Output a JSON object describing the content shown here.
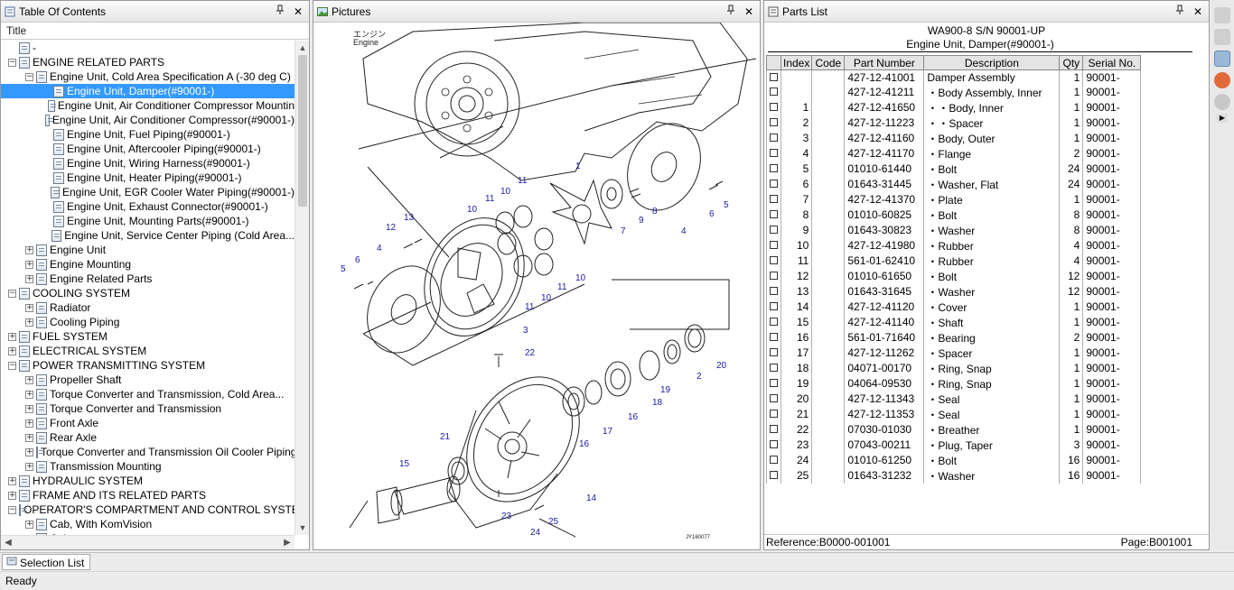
{
  "toc": {
    "title": "Table Of Contents",
    "column": "Title",
    "items": [
      {
        "level": 0,
        "exp": "",
        "label": "-"
      },
      {
        "level": 0,
        "exp": "−",
        "label": "ENGINE RELATED PARTS"
      },
      {
        "level": 1,
        "exp": "−",
        "label": "Engine Unit, Cold Area Specification A (-30 deg C)"
      },
      {
        "level": 2,
        "exp": "",
        "label": "Engine Unit, Damper(#90001-)",
        "selected": true
      },
      {
        "level": 2,
        "exp": "",
        "label": "Engine Unit, Air Conditioner Compressor Mountin"
      },
      {
        "level": 2,
        "exp": "",
        "label": "Engine Unit, Air Conditioner Compressor(#90001-)"
      },
      {
        "level": 2,
        "exp": "",
        "label": "Engine Unit, Fuel Piping(#90001-)"
      },
      {
        "level": 2,
        "exp": "",
        "label": "Engine Unit, Aftercooler Piping(#90001-)"
      },
      {
        "level": 2,
        "exp": "",
        "label": "Engine Unit, Wiring Harness(#90001-)"
      },
      {
        "level": 2,
        "exp": "",
        "label": "Engine Unit, Heater Piping(#90001-)"
      },
      {
        "level": 2,
        "exp": "",
        "label": "Engine Unit, EGR Cooler Water Piping(#90001-)"
      },
      {
        "level": 2,
        "exp": "",
        "label": "Engine Unit, Exhaust Connector(#90001-)"
      },
      {
        "level": 2,
        "exp": "",
        "label": "Engine Unit, Mounting Parts(#90001-)"
      },
      {
        "level": 2,
        "exp": "",
        "label": "Engine Unit, Service Center Piping (Cold Area..."
      },
      {
        "level": 1,
        "exp": "+",
        "label": "Engine Unit"
      },
      {
        "level": 1,
        "exp": "+",
        "label": "Engine Mounting"
      },
      {
        "level": 1,
        "exp": "+",
        "label": "Engine Related Parts"
      },
      {
        "level": 0,
        "exp": "−",
        "label": "COOLING SYSTEM"
      },
      {
        "level": 1,
        "exp": "+",
        "label": "Radiator"
      },
      {
        "level": 1,
        "exp": "+",
        "label": "Cooling Piping"
      },
      {
        "level": 0,
        "exp": "+",
        "label": "FUEL SYSTEM"
      },
      {
        "level": 0,
        "exp": "+",
        "label": "ELECTRICAL SYSTEM"
      },
      {
        "level": 0,
        "exp": "−",
        "label": "POWER TRANSMITTING SYSTEM"
      },
      {
        "level": 1,
        "exp": "+",
        "label": "Propeller Shaft"
      },
      {
        "level": 1,
        "exp": "+",
        "label": "Torque Converter and Transmission, Cold Area..."
      },
      {
        "level": 1,
        "exp": "+",
        "label": "Torque Converter and Transmission"
      },
      {
        "level": 1,
        "exp": "+",
        "label": "Front Axle"
      },
      {
        "level": 1,
        "exp": "+",
        "label": "Rear Axle"
      },
      {
        "level": 1,
        "exp": "+",
        "label": "Torque Converter and Transmission Oil Cooler Piping"
      },
      {
        "level": 1,
        "exp": "+",
        "label": "Transmission Mounting"
      },
      {
        "level": 0,
        "exp": "+",
        "label": "HYDRAULIC SYSTEM"
      },
      {
        "level": 0,
        "exp": "+",
        "label": "FRAME AND ITS RELATED PARTS"
      },
      {
        "level": 0,
        "exp": "−",
        "label": "OPERATOR'S COMPARTMENT AND CONTROL SYSTEM"
      },
      {
        "level": 1,
        "exp": "+",
        "label": "Cab, With KomVision"
      },
      {
        "level": 1,
        "exp": "+",
        "label": "Cab"
      }
    ]
  },
  "pictures": {
    "title": "Pictures",
    "label_jp": "エンジン",
    "label_en": "Engine",
    "drawing_code": "JY160077"
  },
  "parts": {
    "title": "Parts List",
    "model": "WA900-8 S/N 90001-UP",
    "subtitle": "Engine Unit, Damper(#90001-)",
    "columns": [
      "Index",
      "Code",
      "Part Number",
      "Description",
      "Qty",
      "Serial No."
    ],
    "rows": [
      [
        "",
        "",
        "427-12-41001",
        "Damper Assembly",
        "1",
        "90001-"
      ],
      [
        "",
        "",
        "427-12-41211",
        "・Body Assembly, Inner",
        "1",
        "90001-"
      ],
      [
        "1",
        "",
        "427-12-41650",
        "・・Body, Inner",
        "1",
        "90001-"
      ],
      [
        "2",
        "",
        "427-12-11223",
        "・・Spacer",
        "1",
        "90001-"
      ],
      [
        "3",
        "",
        "427-12-41160",
        "・Body, Outer",
        "1",
        "90001-"
      ],
      [
        "4",
        "",
        "427-12-41170",
        "・Flange",
        "2",
        "90001-"
      ],
      [
        "5",
        "",
        "01010-61440",
        "・Bolt",
        "24",
        "90001-"
      ],
      [
        "6",
        "",
        "01643-31445",
        "・Washer, Flat",
        "24",
        "90001-"
      ],
      [
        "7",
        "",
        "427-12-41370",
        "・Plate",
        "1",
        "90001-"
      ],
      [
        "8",
        "",
        "01010-60825",
        "・Bolt",
        "8",
        "90001-"
      ],
      [
        "9",
        "",
        "01643-30823",
        "・Washer",
        "8",
        "90001-"
      ],
      [
        "10",
        "",
        "427-12-41980",
        "・Rubber",
        "4",
        "90001-"
      ],
      [
        "11",
        "",
        "561-01-62410",
        "・Rubber",
        "4",
        "90001-"
      ],
      [
        "12",
        "",
        "01010-61650",
        "・Bolt",
        "12",
        "90001-"
      ],
      [
        "13",
        "",
        "01643-31645",
        "・Washer",
        "12",
        "90001-"
      ],
      [
        "14",
        "",
        "427-12-41120",
        "・Cover",
        "1",
        "90001-"
      ],
      [
        "15",
        "",
        "427-12-41140",
        "・Shaft",
        "1",
        "90001-"
      ],
      [
        "16",
        "",
        "561-01-71640",
        "・Bearing",
        "2",
        "90001-"
      ],
      [
        "17",
        "",
        "427-12-11262",
        "・Spacer",
        "1",
        "90001-"
      ],
      [
        "18",
        "",
        "04071-00170",
        "・Ring, Snap",
        "1",
        "90001-"
      ],
      [
        "19",
        "",
        "04064-09530",
        "・Ring, Snap",
        "1",
        "90001-"
      ],
      [
        "20",
        "",
        "427-12-11343",
        "・Seal",
        "1",
        "90001-"
      ],
      [
        "21",
        "",
        "427-12-11353",
        "・Seal",
        "1",
        "90001-"
      ],
      [
        "22",
        "",
        "07030-01030",
        "・Breather",
        "1",
        "90001-"
      ],
      [
        "23",
        "",
        "07043-00211",
        "・Plug, Taper",
        "3",
        "90001-"
      ],
      [
        "24",
        "",
        "01010-61250",
        "・Bolt",
        "16",
        "90001-"
      ],
      [
        "25",
        "",
        "01643-31232",
        "・Washer",
        "16",
        "90001-"
      ]
    ],
    "reference": "Reference:B0000-001001",
    "page": "Page:B001001"
  },
  "pin_glyph": "📌",
  "close_glyph": "✕",
  "selection_tab": "Selection List",
  "status": "Ready"
}
